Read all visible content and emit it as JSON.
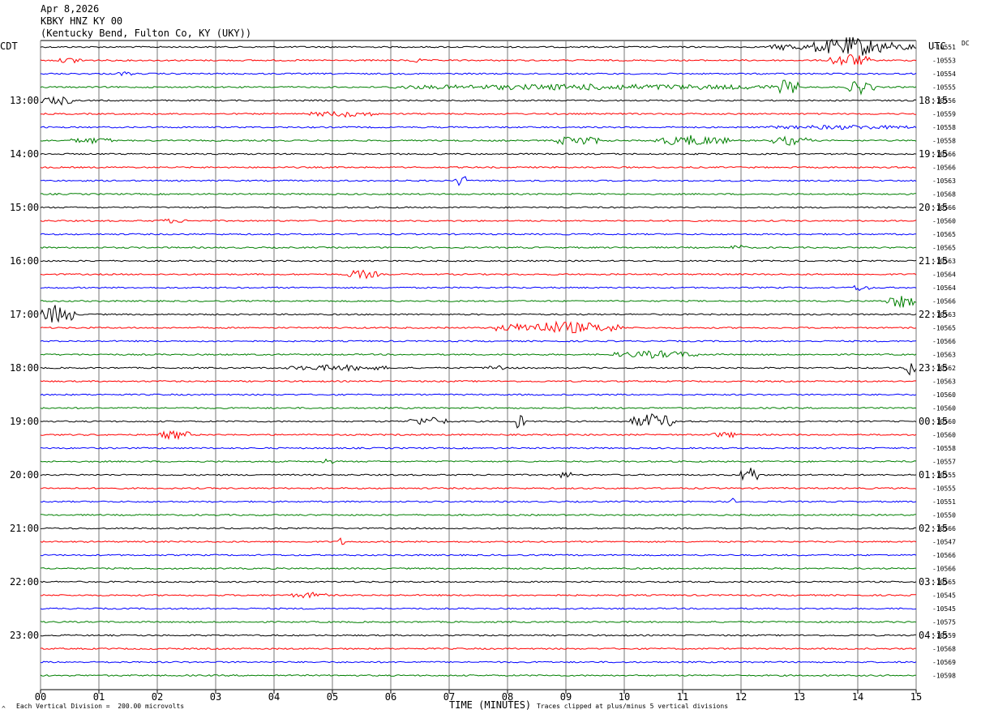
{
  "header": {
    "date": "Apr 8,2026",
    "station": "KBKY HNZ KY 00",
    "location": "(Kentucky Bend, Fulton Co, KY (UKY))"
  },
  "left_tz": "CDT",
  "right_tz": "UTC",
  "dc_label": "DC",
  "footer": {
    "scale_note": "Each Vertical Division =  200.00 microvolts",
    "clip_note": "Traces clipped at plus/minus 5 vertical divisions",
    "corner_mark": "^"
  },
  "colors": {
    "trace_cycle": [
      "#000000",
      "#ff0000",
      "#0000ff",
      "#007f00"
    ],
    "grid": "#000000"
  },
  "chart_data": {
    "type": "line",
    "title": "KBKY HNZ KY 00",
    "xlabel": "TIME (MINUTES)",
    "ylabel": "",
    "xlim": [
      0,
      15
    ],
    "x_ticks": [
      "00",
      "01",
      "02",
      "03",
      "04",
      "05",
      "06",
      "07",
      "08",
      "09",
      "10",
      "11",
      "12",
      "13",
      "14",
      "15"
    ],
    "left_hour_labels": [
      "13:00",
      "14:00",
      "15:00",
      "16:00",
      "17:00",
      "18:00",
      "19:00",
      "20:00",
      "21:00",
      "22:00",
      "23:00"
    ],
    "right_hour_labels": [
      "18:15",
      "19:15",
      "20:15",
      "21:15",
      "22:15",
      "23:15",
      "00:15",
      "01:15",
      "02:15",
      "03:15",
      "04:15"
    ],
    "trace_count": 48,
    "dc_offsets": [
      "-10551",
      "-10553",
      "-10554",
      "-10555",
      "-10556",
      "-10559",
      "-10558",
      "-10558",
      "-10566",
      "-10566",
      "-10563",
      "-10568",
      "-10566",
      "-10560",
      "-10565",
      "-10565",
      "-10563",
      "-10564",
      "-10564",
      "-10566",
      "-10563",
      "-10565",
      "-10566",
      "-10563",
      "-10562",
      "-10563",
      "-10560",
      "-10560",
      "-10560",
      "-10560",
      "-10558",
      "-10557",
      "-10555",
      "-10555",
      "-10551",
      "-10550",
      "-10566",
      "-10547",
      "-10566",
      "-10566",
      "-10565",
      "-10545",
      "-10545",
      "-10575",
      "-10559",
      "-10568",
      "-10569",
      "-10598"
    ]
  }
}
